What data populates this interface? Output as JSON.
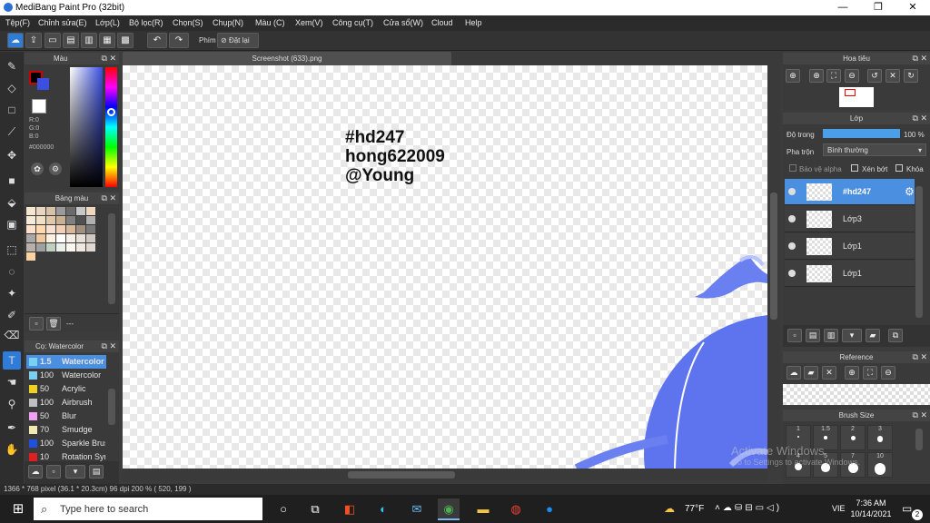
{
  "window": {
    "title": "MediBang Paint Pro (32bit)",
    "minimize": "—",
    "restore": "❐",
    "close": "✕"
  },
  "menu": [
    "Tệp(F)",
    "Chỉnh sửa(E)",
    "Lớp(L)",
    "Bộ lọc(R)",
    "Chọn(S)",
    "Chụp(N)",
    "Màu (C)",
    "Xem(V)",
    "Công cụ(T)",
    "Cửa sổ(W)",
    "Cloud",
    "Help"
  ],
  "toolbar": {
    "key_label": "Phím",
    "reset_label": "Đặt lại"
  },
  "document": {
    "tab_title": "Screenshot (633).png"
  },
  "canvas_text": {
    "line1": "#hd247",
    "line2": "hong622009",
    "line3": "@Young"
  },
  "color_panel": {
    "title": "Màu",
    "r": "R:0",
    "g": "G:0",
    "b": "B:0",
    "hex": "#000000",
    "fg": "#000000",
    "bg": "#3b4fe0"
  },
  "palette_panel": {
    "title": "Bảng màu",
    "footer": "---",
    "swatches": [
      "#f5e6d0",
      "#e8d6c0",
      "#d6c2a8",
      "#9a9a9a",
      "#6b6b6b",
      "#c8c8c8",
      "#f0d8c0",
      "#f8e8d8",
      "#f0e0c8",
      "#e0c8a8",
      "#c8b090",
      "#808080",
      "#505050",
      "#b0b0b0",
      "#ffe0c8",
      "#ffd8b0",
      "#f8e0d0",
      "#f0d0b8",
      "#d8b898",
      "#a09080",
      "#787878",
      "#a8a8a8",
      "#f0c8a0",
      "#fff0e0",
      "#ffffff",
      "#f8f0e8",
      "#e8e0d8",
      "#d0c8c0",
      "#b8b0a8",
      "#a0a0a0",
      "#c0d0c0",
      "#e8f0e8",
      "#f8f8f0",
      "#f0e8e0",
      "#e0d8d0",
      "#ffd0a0"
    ]
  },
  "brush_panel": {
    "title": "Cọ: Watercolor",
    "brushes": [
      {
        "size": "1.5",
        "name": "Watercolor",
        "color": "#7ad0f0",
        "selected": true
      },
      {
        "size": "100",
        "name": "Watercolor",
        "color": "#7ad0f0"
      },
      {
        "size": "50",
        "name": "Acrylic",
        "color": "#f0d020"
      },
      {
        "size": "100",
        "name": "Airbrush",
        "color": "#c0c0c0"
      },
      {
        "size": "50",
        "name": "Blur",
        "color": "#f0a0f0"
      },
      {
        "size": "70",
        "name": "Smudge",
        "color": "#f0e8b0"
      },
      {
        "size": "100",
        "name": "Sparkle Brush",
        "color": "#2050e0"
      },
      {
        "size": "10",
        "name": "Rotation Sym",
        "color": "#e02020"
      }
    ]
  },
  "navigator": {
    "title": "Hoa tiêu"
  },
  "layer_panel": {
    "title": "Lớp",
    "opacity_label": "Độ trong",
    "opacity_value": "100 %",
    "blend_label": "Pha trộn",
    "blend_value": "Bình thường",
    "protect_alpha": "Bảo vệ alpha",
    "clipping": "Xén bớt",
    "lock": "Khóa",
    "layers": [
      {
        "name": "#hd247",
        "selected": true
      },
      {
        "name": "Lớp3"
      },
      {
        "name": "Lớp1"
      },
      {
        "name": "Lớp1"
      }
    ]
  },
  "reference": {
    "title": "Reference"
  },
  "brush_size": {
    "title": "Brush Size",
    "sizes": [
      "1",
      "1.5",
      "2",
      "3",
      "4",
      "5",
      "7",
      "10"
    ]
  },
  "watermark": {
    "line1": "Activate Windows",
    "line2": "Go to Settings to activate Windows."
  },
  "status": {
    "text": "1366 * 768 pixel   (36.1 * 20.3cm)  96 dpi  200 %   ( 520, 199 )"
  },
  "taskbar": {
    "search_placeholder": "Type here to search",
    "weather": "77°F",
    "lang": "VIE",
    "time": "7:36 AM",
    "date": "10/14/2021",
    "notif": "2"
  }
}
